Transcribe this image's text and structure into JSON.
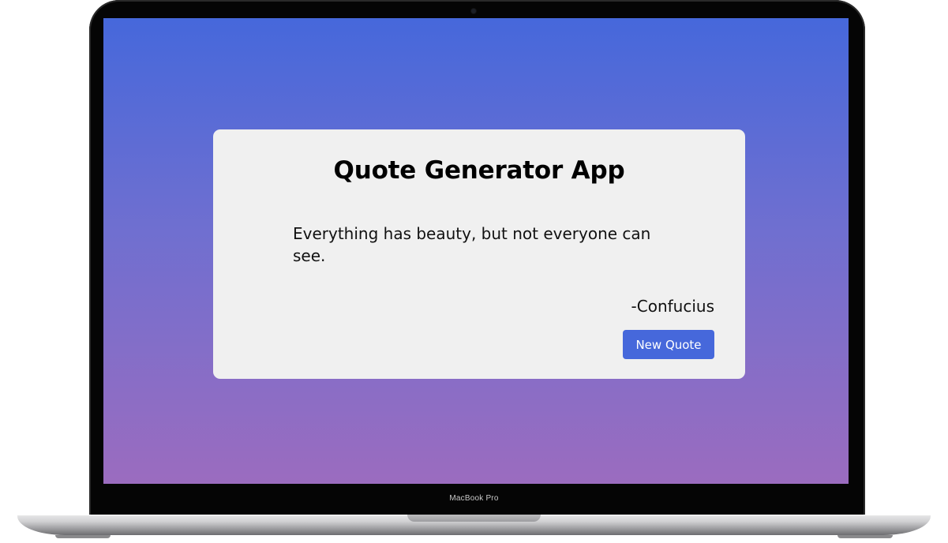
{
  "device": {
    "label": "MacBook Pro"
  },
  "app": {
    "title": "Quote Generator App",
    "quote": "Everything has beauty, but not everyone can see.",
    "author": "-Confucius",
    "new_quote_label": "New Quote"
  },
  "colors": {
    "accent": "#4668db",
    "background_top": "#4668db",
    "background_bottom": "#9b6cbf",
    "card": "#f0f0f0"
  }
}
